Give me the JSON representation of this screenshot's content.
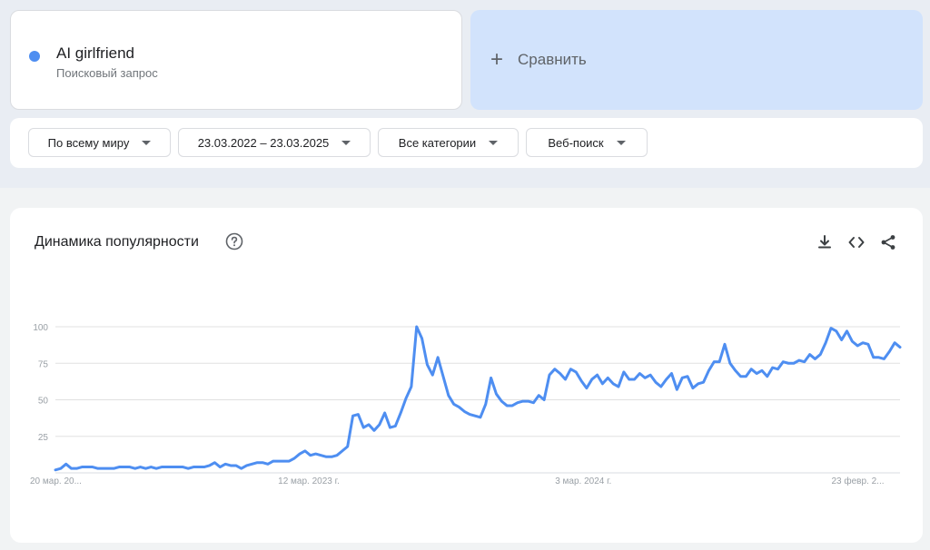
{
  "term": {
    "name": "AI girlfriend",
    "type": "Поисковый запрос",
    "color": "#4e8ef1"
  },
  "compare": {
    "label": "Сравнить",
    "icon": "plus-icon"
  },
  "filters": [
    {
      "label": "По всему миру"
    },
    {
      "label": "23.03.2022 – 23.03.2025"
    },
    {
      "label": "Все категории"
    },
    {
      "label": "Веб-поиск"
    }
  ],
  "chart_header": {
    "title": "Динамика популярности",
    "help_icon": "help-circle-icon",
    "tools": [
      "download-icon",
      "embed-code-icon",
      "share-icon"
    ]
  },
  "chart_data": {
    "type": "line",
    "title": "Динамика популярности",
    "xlabel": "",
    "ylabel": "",
    "ylim": [
      0,
      100
    ],
    "yticks": [
      25,
      50,
      75,
      100
    ],
    "xtick_labels": [
      "20 мар. 20...",
      "12 мар. 2023 г.",
      "3 мар. 2024 г.",
      "23 февр. 2..."
    ],
    "grid": true,
    "color": "#4e8ef1",
    "series": [
      {
        "values": [
          2,
          3,
          6,
          3,
          3,
          4,
          4,
          4,
          3,
          3,
          3,
          3,
          4,
          4,
          4,
          3,
          4,
          3,
          4,
          3,
          4,
          4,
          4,
          4,
          4,
          3,
          4,
          4,
          4,
          5,
          7,
          4,
          6,
          5,
          5,
          3,
          5,
          6,
          7,
          7,
          6,
          8,
          8,
          8,
          8,
          10,
          13,
          15,
          12,
          13,
          12,
          11,
          11,
          12,
          15,
          18,
          39,
          40,
          31,
          33,
          29,
          33,
          41,
          31,
          32,
          41,
          51,
          59,
          100,
          92,
          74,
          67,
          79,
          66,
          53,
          47,
          45,
          42,
          40,
          39,
          38,
          47,
          65,
          54,
          49,
          46,
          46,
          48,
          49,
          49,
          48,
          53,
          50,
          67,
          71,
          68,
          64,
          71,
          69,
          63,
          58,
          64,
          67,
          61,
          65,
          61,
          59,
          69,
          64,
          64,
          68,
          65,
          67,
          62,
          59,
          64,
          68,
          57,
          65,
          66,
          58,
          61,
          62,
          70,
          76,
          76,
          88,
          75,
          70,
          66,
          66,
          71,
          68,
          70,
          66,
          72,
          71,
          76,
          75,
          75,
          77,
          76,
          81,
          78,
          81,
          89,
          99,
          97,
          91,
          97,
          90,
          87,
          89,
          88,
          79,
          79,
          78,
          83,
          89,
          86
        ]
      }
    ]
  }
}
